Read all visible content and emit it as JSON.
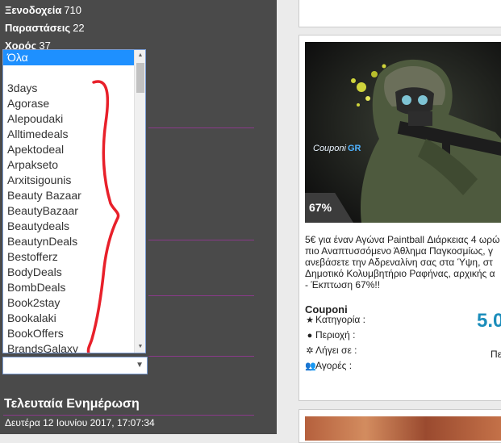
{
  "sidebar": {
    "categories": [
      {
        "label": "Ξενοδοχεία",
        "count": "710"
      },
      {
        "label": "Παραστάσεις",
        "count": "22"
      },
      {
        "label": "Χορός",
        "count": "37"
      }
    ],
    "listbox": {
      "selected": "Όλα",
      "options": [
        "Όλα",
        "",
        "3days",
        "Agorase",
        "Alepoudaki",
        "Alltimedeals",
        "Apektodeal",
        "Arpakseto",
        "Arxitsigounis",
        "Beauty Bazaar",
        "BeautyBazaar",
        "Beautydeals",
        "BeautynDeals",
        "Bestofferz",
        "BodyDeals",
        "BombDeals",
        "Book2stay",
        "Bookalaki",
        "BookOffers",
        "BrandsGalaxy"
      ]
    },
    "select_value": "",
    "last_update": {
      "title": "Τελευταία Ενημέρωση",
      "date": "Δευτέρα 12 Ιουνίου 2017, 17:07:34"
    }
  },
  "deal": {
    "logo_text": "CouponiGR",
    "discount": "67%",
    "description": "5€ για έναν Αγώνα Paintball Διάρκειας 4 ωρώ\nπιο Αναπτυσσόμενο Άθλημα Παγκοσμίως, γ\nανεβάσετε την Αδρεναλίνη σας στα Ύψη, στ\nΔημοτικό Κολυμβητήριο Ραφήνας, αρχικής α\n- Έκπτωση 67%!!",
    "merchant": "Couponi",
    "price": "5.0",
    "meta": [
      {
        "icon": "star-icon",
        "label": "Κατηγορία :"
      },
      {
        "icon": "location-pin-icon",
        "label": "Περιοχή :"
      },
      {
        "icon": "expire-icon",
        "label": "Λήγει σε :"
      },
      {
        "icon": "users-icon",
        "label": "Αγορές :"
      }
    ],
    "category_value": "Πε"
  },
  "colors": {
    "sidebar_bg": "#4a4a4a",
    "divider": "#8a3a8a",
    "selection": "#1e90ff",
    "price": "#1b8dbb",
    "annotation": "#e8202a"
  }
}
